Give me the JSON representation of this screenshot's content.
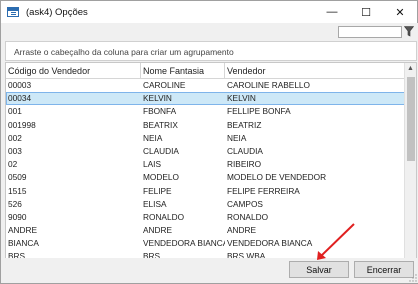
{
  "window": {
    "title": "(ask4)  Opções",
    "minimize_glyph": "—",
    "maximize_glyph": "☐",
    "close_glyph": "✕"
  },
  "filter": {
    "value": "",
    "icon": "filter-funnel-icon"
  },
  "group_panel": {
    "hint": "Arraste o cabeçalho da coluna para criar um agrupamento"
  },
  "grid": {
    "columns": [
      "Código do Vendedor",
      "Nome Fantasia",
      "Vendedor"
    ],
    "rows": [
      [
        "00003",
        "CAROLINE",
        "CAROLINE RABELLO"
      ],
      [
        "00034",
        "KELVIN",
        "KELVIN"
      ],
      [
        "001",
        "FBONFA",
        "FELLIPE BONFA"
      ],
      [
        "001998",
        "BEATRIX",
        "BEATRIZ"
      ],
      [
        "002",
        "NEIA",
        "NEIA"
      ],
      [
        "003",
        "CLAUDIA",
        "CLAUDIA"
      ],
      [
        "02",
        "LAIS",
        "RIBEIRO"
      ],
      [
        "0509",
        "MODELO",
        "MODELO DE VENDEDOR"
      ],
      [
        "1515",
        "FELIPE",
        "FELIPE FERREIRA"
      ],
      [
        "526",
        "ELISA",
        "CAMPOS"
      ],
      [
        "9090",
        "RONALDO",
        "RONALDO"
      ],
      [
        "ANDRE",
        "ANDRE",
        "ANDRE"
      ],
      [
        "BIANCA",
        "VENDEDORA BIANCA",
        "VENDEDORA BIANCA"
      ],
      [
        "BRS",
        "BRS",
        "BRS WBA"
      ]
    ],
    "selected_row": 1
  },
  "buttons": {
    "save": "Salvar",
    "close": "Encerrar"
  },
  "colors": {
    "selection": "#cde8f7",
    "annotation_arrow": "#e02020"
  }
}
